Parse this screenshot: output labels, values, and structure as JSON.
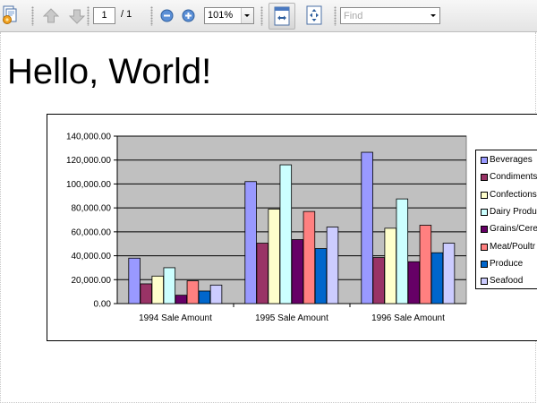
{
  "toolbar": {
    "page_number": "1",
    "page_total": "/ 1",
    "zoom_level": "101%",
    "find_placeholder": "Find",
    "icons": {
      "app": "document-gear-icon",
      "previous": "arrow-up-icon",
      "next": "arrow-down-icon",
      "zoom_out": "zoom-out-icon",
      "zoom_in": "zoom-in-icon",
      "fit_width": "fit-width-icon",
      "fit_page": "fit-page-icon"
    }
  },
  "document": {
    "heading": "Hello, World!"
  },
  "chart_data": {
    "type": "bar",
    "categories": [
      "1994 Sale Amount",
      "1995 Sale Amount",
      "1996 Sale Amount"
    ],
    "ylim": [
      0,
      140000
    ],
    "yticks": [
      "0.00",
      "20,000.00",
      "40,000.00",
      "60,000.00",
      "80,000.00",
      "100,000.00",
      "120,000.00",
      "140,000.00"
    ],
    "grid": true,
    "legend_position": "right",
    "plot_background": "#c0c0c0",
    "series": [
      {
        "name": "Beverages",
        "color": "#9999ff",
        "values": [
          38000,
          102000,
          126500
        ]
      },
      {
        "name": "Condiments",
        "color": "#993366",
        "values": [
          16500,
          50500,
          38500
        ]
      },
      {
        "name": "Confections",
        "color": "#ffffcc",
        "values": [
          23000,
          79000,
          63000
        ]
      },
      {
        "name": "Dairy Produ",
        "color": "#ccffff",
        "values": [
          30000,
          116000,
          87500
        ]
      },
      {
        "name": "Grains/Cere",
        "color": "#660066",
        "values": [
          7000,
          53500,
          35000
        ]
      },
      {
        "name": "Meat/Poultr",
        "color": "#ff8080",
        "values": [
          19000,
          77000,
          65500
        ]
      },
      {
        "name": "Produce",
        "color": "#0066cc",
        "values": [
          10500,
          46000,
          42500
        ]
      },
      {
        "name": "Seafood",
        "color": "#ccccff",
        "values": [
          15500,
          64000,
          50500
        ]
      }
    ]
  }
}
